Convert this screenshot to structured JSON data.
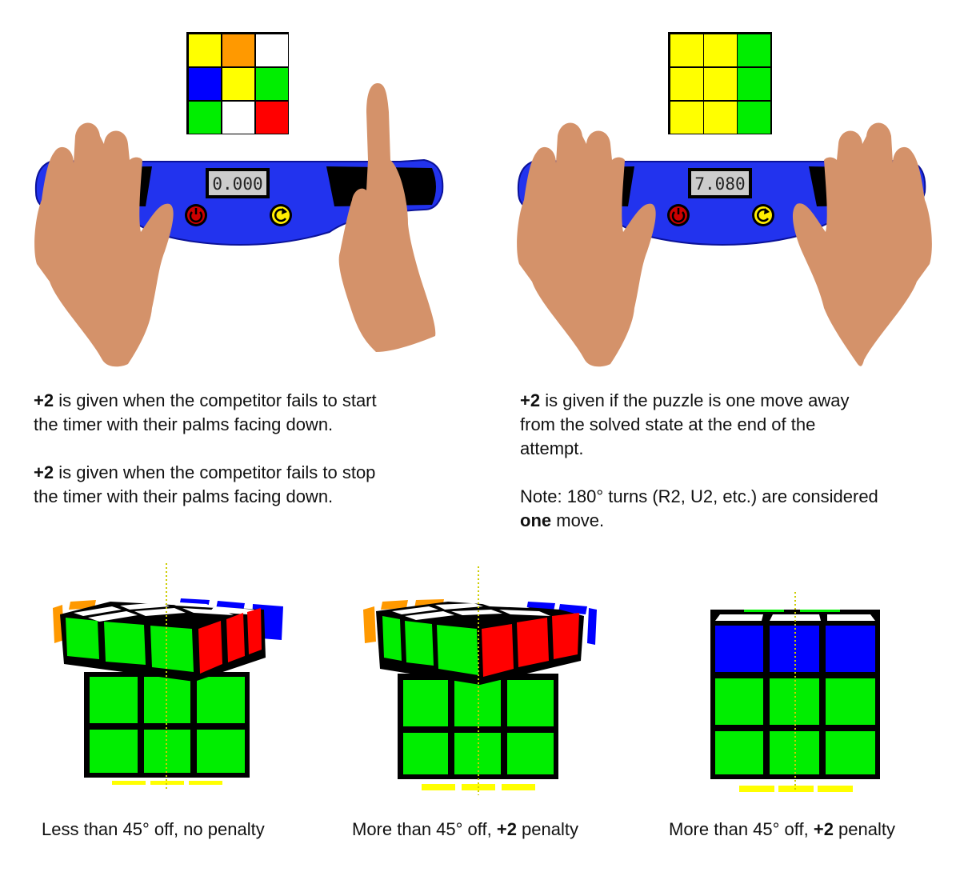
{
  "colors": {
    "white": "#ffffff",
    "yellow": "#ffff00",
    "orange": "#ff9900",
    "blue": "#0000ff",
    "green": "#00ee00",
    "red": "#ff0000",
    "timer_body": "#2233ee",
    "skin": "#d4926a",
    "black": "#000000"
  },
  "timers": [
    {
      "display": "0.000",
      "stop_icon": "power-icon",
      "reset_icon": "reset-arrow-icon"
    },
    {
      "display": "7.080",
      "stop_icon": "power-icon",
      "reset_icon": "reset-arrow-icon"
    }
  ],
  "faces": [
    [
      "yellow",
      "orange",
      "white",
      "blue",
      "yellow",
      "green",
      "green",
      "white",
      "red"
    ],
    [
      "yellow",
      "yellow",
      "green",
      "yellow",
      "yellow",
      "green",
      "yellow",
      "yellow",
      "green"
    ]
  ],
  "left_text": {
    "p1_bold": "+2",
    "p1_rest": " is given when the competitor fails to start\nthe timer with their palms facing down.",
    "p2_bold": "+2",
    "p2_rest": " is given when the competitor fails to stop\nthe timer with their palms facing down."
  },
  "right_text": {
    "p1_bold": "+2",
    "p1_rest": " is given if the puzzle is one move away\nfrom the solved state at the end of the\nattempt.",
    "note_prefix": "Note: 180° turns (R2, U2, etc.) are considered\n",
    "note_bold": "one",
    "note_suffix": " move."
  },
  "captions": [
    {
      "text": "Less than 45° off, no penalty",
      "bold": "",
      "suffix": ""
    },
    {
      "text": "More than 45° off, ",
      "bold": "+2",
      "suffix": " penalty"
    },
    {
      "text": "More than 45° off, ",
      "bold": "+2",
      "suffix": " penalty"
    }
  ]
}
